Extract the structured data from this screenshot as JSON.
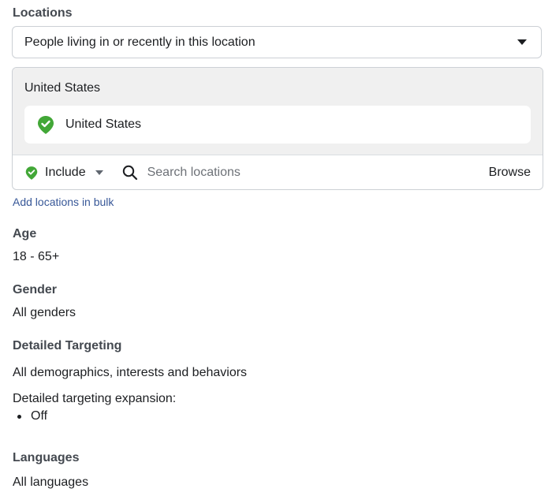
{
  "locations": {
    "heading": "Locations",
    "dropdown_value": "People living in or recently in this location",
    "group_title": "United States",
    "selected": [
      {
        "label": "United States",
        "status": "included"
      }
    ],
    "include_label": "Include",
    "search_placeholder": "Search locations",
    "browse_label": "Browse",
    "bulk_link": "Add locations in bulk"
  },
  "age": {
    "heading": "Age",
    "value": "18 - 65+"
  },
  "gender": {
    "heading": "Gender",
    "value": "All genders"
  },
  "detailed_targeting": {
    "heading": "Detailed Targeting",
    "value": "All demographics, interests and behaviors",
    "expansion_label": "Detailed targeting expansion:",
    "expansion_value": "Off"
  },
  "languages": {
    "heading": "Languages",
    "value": "All languages"
  },
  "colors": {
    "include_green": "#42a737",
    "link_blue": "#385898",
    "border": "#ccd0d5",
    "panel_bg": "#f0f0f0"
  },
  "icons": [
    "chevron-down-icon",
    "location-pin-check-icon",
    "search-icon"
  ]
}
